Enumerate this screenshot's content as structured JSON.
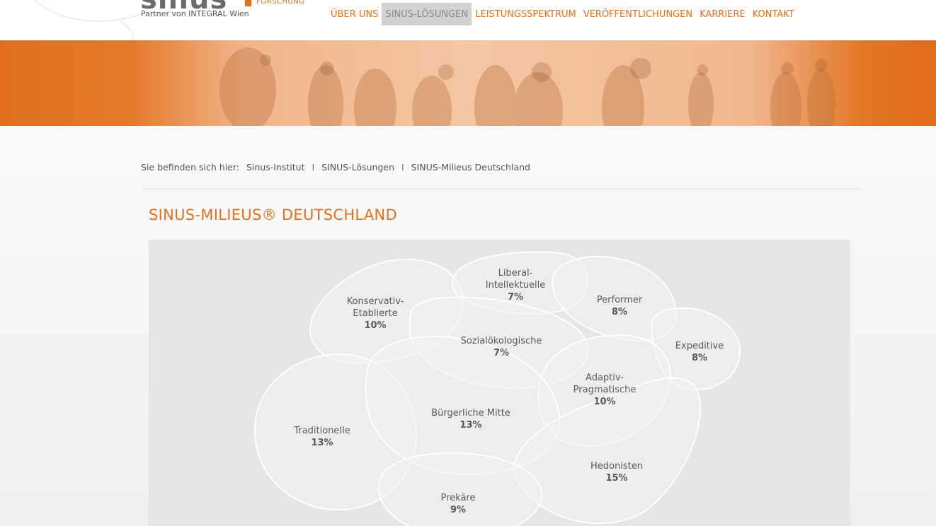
{
  "logo": {
    "word": "sinus",
    "sub": "FORSCHUNG",
    "partner": "Partner von INTEGRAL Wien"
  },
  "nav": {
    "items": [
      {
        "label": "ÜBER UNS",
        "active": false
      },
      {
        "label": "SINUS-LÖSUNGEN",
        "active": true
      },
      {
        "label": "LEISTUNGSSPEKTRUM",
        "active": false
      },
      {
        "label": "VERÖFFENTLICHUNGEN",
        "active": false
      },
      {
        "label": "KARRIERE",
        "active": false
      },
      {
        "label": "KONTAKT",
        "active": false
      }
    ]
  },
  "breadcrumb": {
    "prefix": "Sie befinden sich hier:",
    "items": [
      "Sinus-Institut",
      "SINUS-Lösungen",
      "SINUS-Milieus Deutschland"
    ],
    "separator": "I"
  },
  "page": {
    "title": "SINUS-MILIEUS® DEUTSCHLAND"
  },
  "colors": {
    "accent": "#e0711f",
    "panel": "#e6e6e6",
    "blob_fill": "#f2f2f2",
    "blob_stroke": "#ffffff",
    "text": "#5a5a5a"
  },
  "milieus": [
    {
      "name_lines": [
        "Konservativ-",
        "Etablierte"
      ],
      "percent": "10%"
    },
    {
      "name_lines": [
        "Liberal-",
        "Intellektuelle"
      ],
      "percent": "7%"
    },
    {
      "name_lines": [
        "Performer"
      ],
      "percent": "8%"
    },
    {
      "name_lines": [
        "Expeditive"
      ],
      "percent": "8%"
    },
    {
      "name_lines": [
        "Sozialökologische"
      ],
      "percent": "7%"
    },
    {
      "name_lines": [
        "Adaptiv-",
        "Pragmatische"
      ],
      "percent": "10%"
    },
    {
      "name_lines": [
        "Traditionelle"
      ],
      "percent": "13%"
    },
    {
      "name_lines": [
        "Bürgerliche Mitte"
      ],
      "percent": "13%"
    },
    {
      "name_lines": [
        "Hedonisten"
      ],
      "percent": "15%"
    },
    {
      "name_lines": [
        "Prekäre"
      ],
      "percent": "9%"
    }
  ]
}
